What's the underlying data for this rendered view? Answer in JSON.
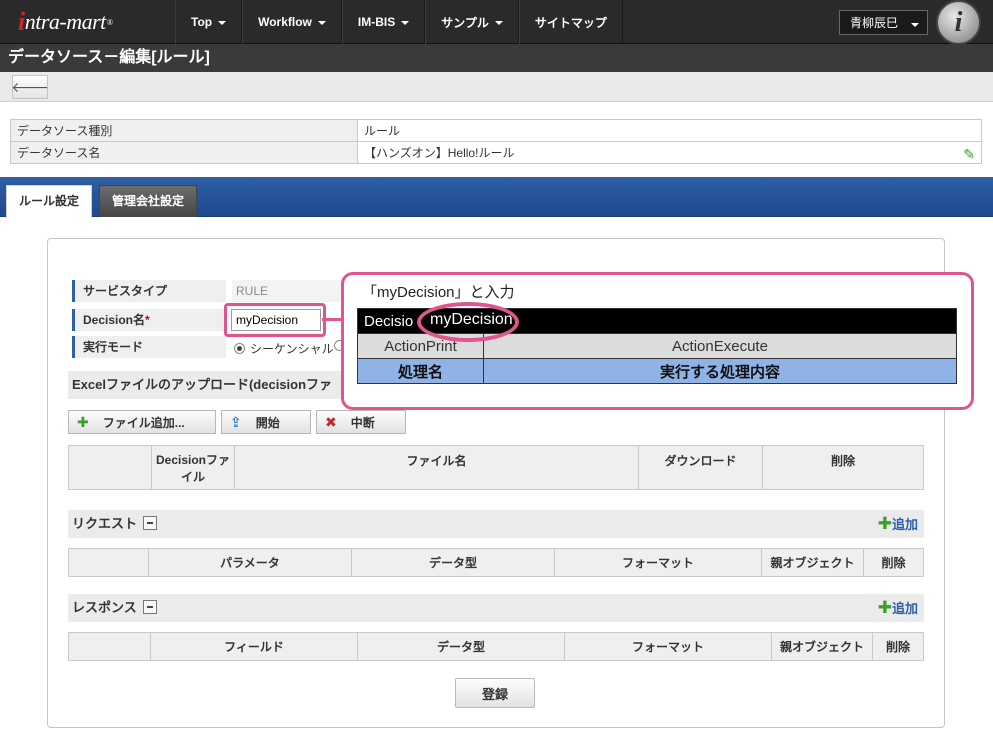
{
  "header": {
    "logo": {
      "mark": "i",
      "text": "ntra-mart",
      "reg": "®"
    },
    "nav": [
      {
        "label": "Top",
        "dropdown": true
      },
      {
        "label": "Workflow",
        "dropdown": true
      },
      {
        "label": "IM-BIS",
        "dropdown": true
      },
      {
        "label": "サンプル",
        "dropdown": true
      },
      {
        "label": "サイトマップ",
        "dropdown": false
      }
    ],
    "user": "青柳辰巳",
    "info_icon": "i"
  },
  "page_title": "データソース－編集[ルール]",
  "toolbar": {
    "back_icon": "🡐"
  },
  "info": {
    "rows": [
      {
        "label": "データソース種別",
        "value": "ルール"
      },
      {
        "label": "データソース名",
        "value": "【ハンズオン】Hello!ルール"
      }
    ]
  },
  "tabs": {
    "active": "ルール設定",
    "inactive": "管理会社設定"
  },
  "form": {
    "service_type": {
      "label": "サービスタイプ",
      "value": "RULE"
    },
    "decision": {
      "label": "Decision名",
      "required": "*",
      "value": "myDecision"
    },
    "mode": {
      "label": "実行モード",
      "option": "シーケンシャル"
    }
  },
  "upload": {
    "title": "Excelファイルのアップロード(decisionファ",
    "buttons": {
      "add": "ファイル追加...",
      "start": "開始",
      "stop": "中断"
    },
    "columns": [
      "",
      "Decisionファイル",
      "ファイル名",
      "ダウンロード",
      "削除"
    ]
  },
  "request": {
    "title": "リクエスト",
    "add": "追加",
    "columns": [
      "",
      "パラメータ",
      "データ型",
      "フォーマット",
      "親オブジェクト",
      "削除"
    ]
  },
  "response": {
    "title": "レスポンス",
    "add": "追加",
    "columns": [
      "",
      "フィールド",
      "データ型",
      "フォーマット",
      "親オブジェクト",
      "削除"
    ]
  },
  "register": "登録",
  "callout": {
    "title": "「myDecision」と入力",
    "row1_left": "Decisio",
    "row1_value": "myDecision",
    "row2": [
      "ActionPrint",
      "ActionExecute"
    ],
    "row3": [
      "処理名",
      "実行する処理内容"
    ]
  },
  "colors": {
    "accent_blue": "#2f5fa6",
    "highlight_pink": "#e0558d",
    "header_dark": "#2a2a2a"
  }
}
